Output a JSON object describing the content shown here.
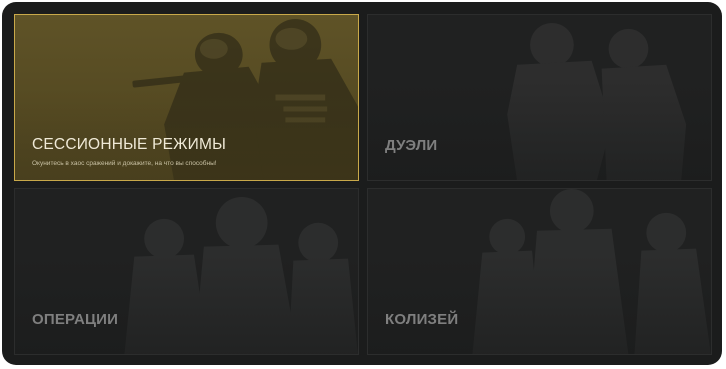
{
  "modes": [
    {
      "title": "СЕССИОННЫЕ РЕЖИМЫ",
      "description": "Окунитесь в хаос сражений и докажите, на что вы способны!",
      "selected": true,
      "icon": "soldiers-aiming-icon"
    },
    {
      "title": "ДУЭЛИ",
      "description": "",
      "selected": false,
      "icon": "soldiers-duel-icon"
    },
    {
      "title": "ОПЕРАЦИИ",
      "description": "",
      "selected": false,
      "icon": "squad-icon"
    },
    {
      "title": "КОЛИЗЕЙ",
      "description": "",
      "selected": false,
      "icon": "arena-fighters-icon"
    }
  ],
  "colors": {
    "selected_border": "#c9a94a",
    "selected_fill": "#5a4e25",
    "tile_fill": "#202121",
    "frame_fill": "#1b1c1c"
  }
}
